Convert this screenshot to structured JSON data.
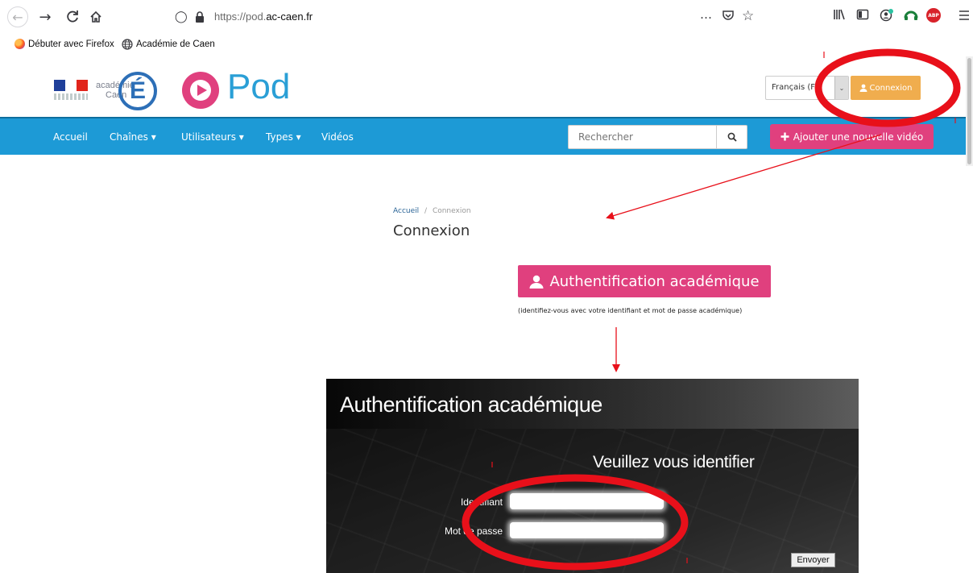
{
  "browser": {
    "url_prefix": "https://pod.",
    "url_domain": "ac-caen.fr",
    "more_label": "…",
    "bookmarks": [
      {
        "label": "Débuter avec Firefox"
      },
      {
        "label": "Académie de Caen"
      }
    ],
    "toolbar_icons": [
      "library-icon",
      "sidebar-icon",
      "account-icon",
      "extension-icon",
      "adblock-icon",
      "menu-icon"
    ],
    "adblock_label": "ABP"
  },
  "header": {
    "academy_logo_line1": "académie",
    "academy_logo_line2": "Caen",
    "academy_logo_letter": "É",
    "pod_logo_text": "Pod",
    "language_value": "Français (FR",
    "login_label": "Connexion"
  },
  "navbar": {
    "items": [
      {
        "label": "Accueil"
      },
      {
        "label": "Chaînes ▾"
      },
      {
        "label": "Utilisateurs ▾"
      },
      {
        "label": "Types ▾"
      },
      {
        "label": "Vidéos"
      }
    ],
    "search_placeholder": "Rechercher",
    "add_video_label": "Ajouter une nouvelle vidéo"
  },
  "page": {
    "breadcrumb_home": "Accueil",
    "breadcrumb_sep": "/",
    "breadcrumb_current": "Connexion",
    "title": "Connexion",
    "auth_button_label": "Authentification académique",
    "auth_hint": "(identifiez-vous avec votre identifiant et mot de passe académique)"
  },
  "cas_form": {
    "title": "Authentification académique",
    "subtitle": "Veuillez vous identifier",
    "username_label": "Identifiant",
    "password_label": "Mot de passe",
    "submit_label": "Envoyer"
  },
  "colors": {
    "navbar": "#1d9ad6",
    "pink": "#e0407e",
    "orange": "#f0ad4e",
    "annotation_red": "#e8101a"
  }
}
